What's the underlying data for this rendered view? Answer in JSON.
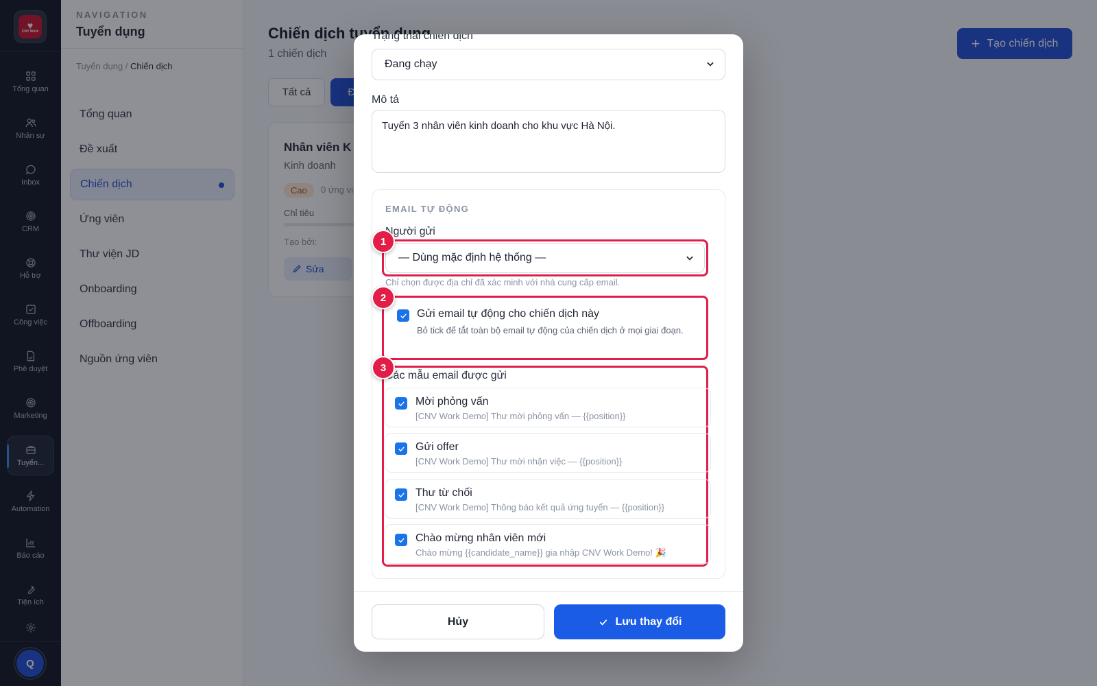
{
  "rail": {
    "logo_text": "CNV Work",
    "items": [
      {
        "label": "Tổng quan",
        "icon": "grid-icon"
      },
      {
        "label": "Nhân sự",
        "icon": "users-icon"
      },
      {
        "label": "Inbox",
        "icon": "chat-icon"
      },
      {
        "label": "CRM",
        "icon": "target-icon"
      },
      {
        "label": "Hỗ trợ",
        "icon": "lifebuoy-icon"
      },
      {
        "label": "Công việc",
        "icon": "check-square-icon"
      },
      {
        "label": "Phê duyệt",
        "icon": "file-sign-icon"
      },
      {
        "label": "Marketing",
        "icon": "target-icon"
      },
      {
        "label": "Tuyển...",
        "icon": "briefcase-icon"
      },
      {
        "label": "Automation",
        "icon": "bolt-icon"
      },
      {
        "label": "Báo cáo",
        "icon": "bar-chart-icon"
      },
      {
        "label": "Tiện ích",
        "icon": "wrench-icon"
      }
    ],
    "avatar_initial": "Q"
  },
  "sidebar": {
    "eyebrow": "NAVIGATION",
    "title": "Tuyển dụng",
    "breadcrumb_parent": "Tuyển dụng",
    "breadcrumb_sep": " / ",
    "breadcrumb_current": "Chiến dịch",
    "items": [
      {
        "label": "Tổng quan"
      },
      {
        "label": "Đề xuất"
      },
      {
        "label": "Chiến dịch"
      },
      {
        "label": "Ứng viên"
      },
      {
        "label": "Thư viện JD"
      },
      {
        "label": "Onboarding"
      },
      {
        "label": "Offboarding"
      },
      {
        "label": "Nguồn ứng viên"
      }
    ]
  },
  "main": {
    "title": "Chiến dịch tuyển dụng",
    "subtitle": "1 chiến dịch",
    "create_label": "Tạo chiến dịch",
    "filters": [
      "Tất cả",
      "Đa"
    ],
    "card": {
      "title": "Nhân viên K",
      "department": "Kinh doanh",
      "priority": "Cao",
      "count": "0 ứng vi",
      "quota_label": "Chỉ tiêu",
      "created_by_label": "Tạo bởi:",
      "edit_label": "Sửa"
    }
  },
  "modal": {
    "status_label": "Trạng thái chiến dịch",
    "status_value": "Đang chạy",
    "desc_label": "Mô tả",
    "desc_value": "Tuyển 3 nhân viên kinh doanh cho khu vực Hà Nội.",
    "email_section": {
      "heading": "EMAIL TỰ ĐỘNG",
      "sender_label": "Người gửi",
      "sender_value": "— Dùng mặc định hệ thống —",
      "sender_hint": "Chỉ chọn được địa chỉ đã xác minh với nhà cung cấp email.",
      "auto_send_label": "Gửi email tự động cho chiến dịch này",
      "auto_send_hint": "Bỏ tick để tắt toàn bộ email tự động của chiến dịch ở mọi giai đoạn.",
      "auto_send_checked": true,
      "templates_label": "Các mẫu email được gửi",
      "templates": [
        {
          "name": "Mời phỏng vấn",
          "subject": "[CNV Work Demo] Thư mời phỏng vấn — {{position}}",
          "checked": true
        },
        {
          "name": "Gửi offer",
          "subject": "[CNV Work Demo] Thư mời nhận việc — {{position}}",
          "checked": true
        },
        {
          "name": "Thư từ chối",
          "subject": "[CNV Work Demo] Thông báo kết quả ứng tuyển — {{position}}",
          "checked": true
        },
        {
          "name": "Chào mừng nhân viên mới",
          "subject": "Chào mừng {{candidate_name}} gia nhập CNV Work Demo! 🎉",
          "checked": true
        }
      ]
    },
    "markers": [
      "1",
      "2",
      "3"
    ],
    "cancel_label": "Hủy",
    "save_label": "Lưu thay đổi"
  },
  "colors": {
    "primary": "#1d4ed8",
    "highlight": "#e11d48",
    "rail_bg": "#0f1524"
  }
}
